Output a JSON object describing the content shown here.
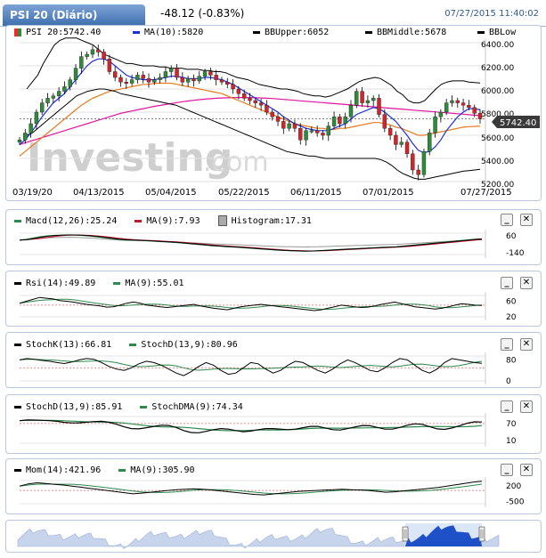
{
  "header": {
    "title": "PSI 20 (Diário)",
    "change": "-48.12 (-0.83%)",
    "timestamp": "07/27/2015 11:40:02"
  },
  "colors": {
    "price_line": "#000000",
    "ma10": "#1d2fdc",
    "bb": "#000000",
    "bbmiddle_orange": "#e87a1c",
    "magenta": "#e0149e",
    "up_candle": "#2e8b3a",
    "down_candle": "#d6232a",
    "signal_red": "#c2182b",
    "green_line": "#2c8a4c",
    "nav_fill": "#1e50c8"
  },
  "main_chart": {
    "legend": [
      {
        "label": "PSI 20:5742.40",
        "color": "#ef2b2b",
        "icon": "candle-icon"
      },
      {
        "label": "MA(10):5820",
        "color": "#1d2fdc"
      },
      {
        "label": "BBUpper:6052",
        "color": "#000000"
      },
      {
        "label": "BBMiddle:5678",
        "color": "#000000"
      },
      {
        "label": "BBLow",
        "color": "#000000"
      }
    ],
    "current_price_label": "5742.40",
    "watermark_bold": "Investing",
    "watermark_light": ".com",
    "y_ticks": [
      "6400.00",
      "6200.00",
      "6000.00",
      "5800.00",
      "5600.00",
      "5400.00",
      "5200.00"
    ],
    "x_ticks": [
      "03/19/20",
      "04/13/2015",
      "05/04/2015",
      "05/22/2015",
      "06/11/2015",
      "07/01/2015",
      "07/27/2015"
    ]
  },
  "indicators": [
    {
      "legend": [
        {
          "label": "Macd(12,26):25.24",
          "color": "#2c8a4c"
        },
        {
          "label": "MA(9):7.93",
          "color": "#c2182b"
        },
        {
          "label": "Histogram:17.31",
          "color": "#999999",
          "box": true
        }
      ],
      "y_ticks": [
        "60",
        "-140"
      ]
    },
    {
      "legend": [
        {
          "label": "Rsi(14):49.89",
          "color": "#000000"
        },
        {
          "label": "MA(9):55.01",
          "color": "#2c8a4c"
        }
      ],
      "y_ticks": [
        "60",
        "20"
      ]
    },
    {
      "legend": [
        {
          "label": "StochK(13):66.81",
          "color": "#000000"
        },
        {
          "label": "StochD(13,9):80.96",
          "color": "#2c8a4c"
        }
      ],
      "y_ticks": [
        "80",
        "0"
      ]
    },
    {
      "legend": [
        {
          "label": "StochD(13,9):85.91",
          "color": "#000000"
        },
        {
          "label": "StochDMA(9):74.34",
          "color": "#2c8a4c"
        }
      ],
      "y_ticks": [
        "70",
        "10"
      ]
    },
    {
      "legend": [
        {
          "label": "Mom(14):421.96",
          "color": "#000000"
        },
        {
          "label": "MA(9):305.90",
          "color": "#2c8a4c"
        }
      ],
      "y_ticks": [
        "200",
        "-500"
      ]
    }
  ],
  "panel_buttons": {
    "minimize": "_",
    "close": "✕"
  },
  "chart_data": {
    "type": "candlestick",
    "title": "PSI 20 (Diário)",
    "ylim": [
      5150,
      6480
    ],
    "x_range": [
      "03/19/2015",
      "07/27/2015"
    ],
    "close_approx": [
      5560,
      5620,
      5700,
      5800,
      5880,
      5920,
      5940,
      5980,
      6020,
      6080,
      6180,
      6280,
      6300,
      6340,
      6320,
      6260,
      6150,
      6100,
      6060,
      6050,
      6080,
      6120,
      6090,
      6060,
      6080,
      6100,
      6150,
      6180,
      6100,
      6060,
      6090,
      6070,
      6110,
      6150,
      6120,
      6080,
      6060,
      6040,
      6000,
      5960,
      5920,
      5900,
      5880,
      5860,
      5800,
      5760,
      5720,
      5660,
      5700,
      5660,
      5560,
      5640,
      5640,
      5620,
      5600,
      5680,
      5760,
      5700,
      5760,
      5860,
      5980,
      5880,
      5900,
      5920,
      5780,
      5660,
      5600,
      5520,
      5540,
      5440,
      5300,
      5260,
      5460,
      5620,
      5760,
      5800,
      5880,
      5900,
      5880,
      5860,
      5840,
      5790,
      5742
    ],
    "ma10_approx": [
      5520,
      5560,
      5620,
      5690,
      5760,
      5820,
      5880,
      5920,
      5960,
      6020,
      6080,
      6140,
      6200,
      6240,
      6260,
      6260,
      6240,
      6200,
      6160,
      6120,
      6100,
      6090,
      6080,
      6080,
      6080,
      6090,
      6100,
      6110,
      6110,
      6100,
      6090,
      6090,
      6090,
      6100,
      6100,
      6090,
      6080,
      6060,
      6040,
      6010,
      5980,
      5950,
      5920,
      5890,
      5860,
      5830,
      5800,
      5760,
      5730,
      5700,
      5680,
      5660,
      5650,
      5640,
      5640,
      5640,
      5660,
      5680,
      5700,
      5740,
      5780,
      5800,
      5820,
      5840,
      5830,
      5800,
      5760,
      5720,
      5660,
      5600,
      5530,
      5470,
      5450,
      5460,
      5500,
      5560,
      5640,
      5700,
      5760,
      5800,
      5830,
      5830,
      5820
    ],
    "bb_upper_approx": [
      6000,
      6060,
      6120,
      6220,
      6300,
      6380,
      6420,
      6440,
      6440,
      6440,
      6420,
      6400,
      6380,
      6340,
      6300,
      6280,
      6260,
      6240,
      6220,
      6220,
      6210,
      6200,
      6200,
      6200,
      6190,
      6190,
      6180,
      6180,
      6180,
      6170,
      6170,
      6170,
      6160,
      6160,
      6150,
      6150,
      6140,
      6120,
      6100,
      6090,
      6080,
      6060,
      6040,
      6030,
      6020,
      6010,
      6000,
      6000,
      5990,
      5980,
      5960,
      5950,
      5940,
      5940,
      5930,
      5940,
      5960,
      5980,
      6000,
      6030,
      6060,
      6080,
      6090,
      6100,
      6090,
      6060,
      6030,
      5980,
      5950,
      5900,
      5880,
      5880,
      5900,
      5950,
      6000,
      6040,
      6060,
      6070,
      6070,
      6070,
      6060,
      6055,
      6052
    ],
    "bb_lower_approx": [
      5600,
      5620,
      5660,
      5700,
      5740,
      5780,
      5820,
      5860,
      5900,
      5940,
      5960,
      5980,
      5990,
      6000,
      6000,
      5990,
      5980,
      5960,
      5950,
      5940,
      5930,
      5920,
      5910,
      5900,
      5890,
      5880,
      5870,
      5860,
      5840,
      5820,
      5800,
      5780,
      5760,
      5740,
      5720,
      5700,
      5680,
      5660,
      5640,
      5620,
      5600,
      5580,
      5560,
      5540,
      5520,
      5500,
      5480,
      5460,
      5450,
      5440,
      5430,
      5420,
      5420,
      5410,
      5400,
      5400,
      5400,
      5400,
      5400,
      5400,
      5400,
      5400,
      5400,
      5400,
      5390,
      5370,
      5340,
      5300,
      5270,
      5250,
      5230,
      5220,
      5220,
      5230,
      5240,
      5250,
      5260,
      5270,
      5280,
      5290,
      5295,
      5300,
      5305
    ],
    "bb_middle_approx": [
      5420,
      5460,
      5500,
      5540,
      5580,
      5620,
      5660,
      5700,
      5740,
      5780,
      5820,
      5860,
      5890,
      5920,
      5940,
      5960,
      5980,
      5990,
      6000,
      6010,
      6020,
      6030,
      6040,
      6040,
      6050,
      6050,
      6050,
      6050,
      6040,
      6030,
      6020,
      6010,
      6000,
      5990,
      5980,
      5970,
      5960,
      5940,
      5920,
      5900,
      5880,
      5860,
      5840,
      5820,
      5800,
      5780,
      5760,
      5740,
      5720,
      5700,
      5690,
      5680,
      5670,
      5660,
      5660,
      5650,
      5650,
      5660,
      5660,
      5670,
      5680,
      5690,
      5700,
      5710,
      5710,
      5700,
      5690,
      5670,
      5660,
      5640,
      5620,
      5600,
      5600,
      5610,
      5620,
      5630,
      5640,
      5650,
      5660,
      5670,
      5675,
      5677,
      5678
    ],
    "ma_long_approx": [
      5520,
      5535,
      5550,
      5565,
      5580,
      5595,
      5610,
      5625,
      5640,
      5655,
      5670,
      5685,
      5700,
      5715,
      5730,
      5745,
      5760,
      5775,
      5790,
      5800,
      5810,
      5820,
      5830,
      5840,
      5850,
      5858,
      5866,
      5874,
      5882,
      5890,
      5896,
      5902,
      5908,
      5912,
      5916,
      5920,
      5922,
      5924,
      5926,
      5926,
      5926,
      5926,
      5924,
      5922,
      5920,
      5918,
      5914,
      5910,
      5906,
      5902,
      5898,
      5894,
      5890,
      5886,
      5882,
      5878,
      5874,
      5870,
      5866,
      5862,
      5858,
      5854,
      5850,
      5846,
      5842,
      5838,
      5834,
      5830,
      5826,
      5822,
      5818,
      5814,
      5810,
      5806,
      5802,
      5798,
      5794,
      5790,
      5786,
      5782,
      5778,
      5774,
      5770
    ],
    "macd_approx": [
      10,
      20,
      35,
      50,
      60,
      65,
      68,
      70,
      68,
      62,
      55,
      45,
      35,
      25,
      15,
      10,
      8,
      5,
      0,
      -5,
      -10,
      -15,
      -20,
      -28,
      -35,
      -42,
      -50,
      -58,
      -62,
      -68,
      -72,
      -78,
      -84,
      -90,
      -96,
      -102,
      -108,
      -112,
      -116,
      -118,
      -120,
      -118,
      -115,
      -110,
      -105,
      -100,
      -96,
      -92,
      -88,
      -84,
      -80,
      -76,
      -72,
      -68,
      -60,
      -52,
      -44,
      -36,
      -28,
      -20,
      -12,
      -4,
      4,
      12,
      20,
      25
    ],
    "rsi_approx": [
      55,
      60,
      65,
      70,
      68,
      66,
      62,
      60,
      58,
      55,
      52,
      50,
      48,
      45,
      46,
      50,
      55,
      58,
      55,
      50,
      48,
      46,
      44,
      46,
      48,
      50,
      52,
      48,
      45,
      42,
      40,
      38,
      42,
      46,
      48,
      50,
      52,
      50,
      48,
      46,
      44,
      42,
      40,
      38,
      36,
      38,
      42,
      46,
      50,
      48,
      46,
      44,
      45,
      48,
      52,
      55,
      58,
      54,
      50,
      46,
      44,
      42,
      40,
      42,
      46,
      50,
      54,
      52,
      50,
      49
    ],
    "stochk_approx": [
      80,
      85,
      82,
      78,
      75,
      70,
      66,
      72,
      80,
      85,
      82,
      70,
      55,
      45,
      40,
      50,
      65,
      75,
      70,
      60,
      45,
      30,
      20,
      35,
      55,
      70,
      60,
      40,
      25,
      30,
      50,
      70,
      65,
      45,
      30,
      40,
      60,
      75,
      70,
      55,
      40,
      30,
      45,
      65,
      80,
      70,
      55,
      40,
      35,
      50,
      70,
      85,
      80,
      60,
      40,
      30,
      45,
      70,
      85,
      80,
      75,
      70,
      67
    ],
    "momentum_approx": [
      200,
      300,
      350,
      320,
      280,
      250,
      200,
      150,
      100,
      50,
      0,
      -50,
      -100,
      -150,
      -120,
      -80,
      -40,
      0,
      40,
      60,
      80,
      60,
      20,
      -20,
      -60,
      -100,
      -140,
      -180,
      -200,
      -160,
      -120,
      -80,
      -40,
      -20,
      0,
      20,
      40,
      60,
      40,
      20,
      0,
      -40,
      -80,
      -60,
      -20,
      20,
      60,
      100,
      140,
      200,
      260,
      320,
      380,
      422
    ]
  }
}
